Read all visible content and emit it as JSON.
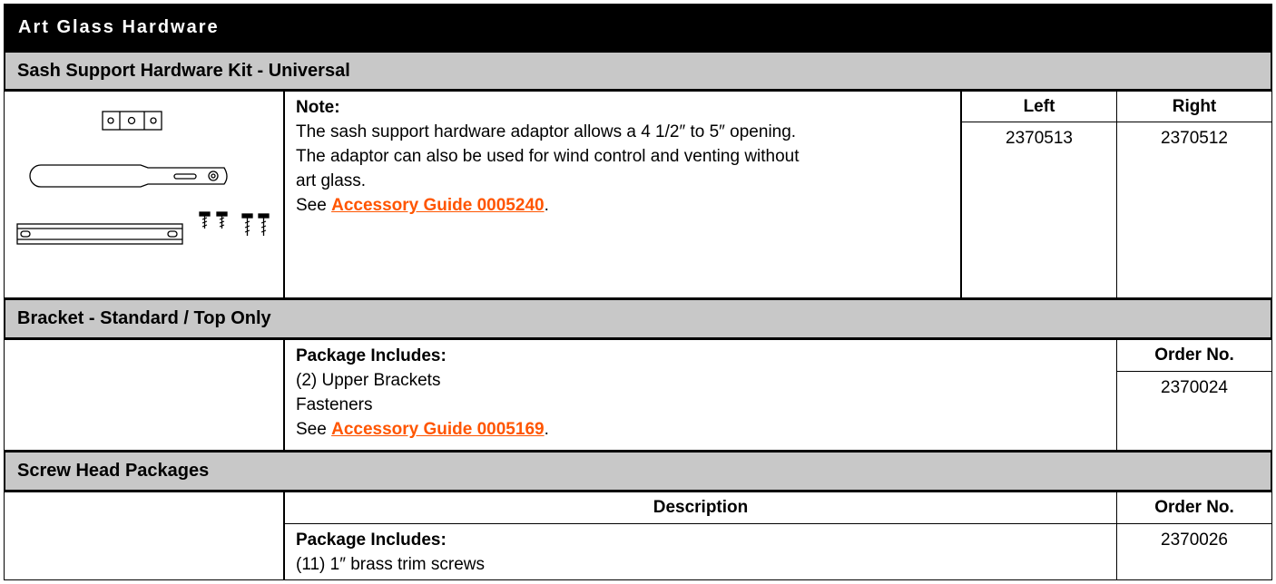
{
  "title": "Art Glass Hardware",
  "sash": {
    "heading": "Sash Support Hardware Kit - Universal",
    "note_label": "Note:",
    "note_line1": "The sash support hardware adaptor allows a 4 1/2″ to 5″ opening.",
    "note_line2": "The adaptor can also be used for wind control and venting without",
    "note_line3": "art glass.",
    "see_prefix": "See ",
    "guide_link": "Accessory Guide 0005240",
    "see_suffix": ".",
    "col_left": "Left",
    "col_right": "Right",
    "left_value": "2370513",
    "right_value": "2370512"
  },
  "bracket": {
    "heading": "Bracket - Standard / Top Only",
    "includes_label": "Package Includes:",
    "item1": "(2) Upper Brackets",
    "item2": "Fasteners",
    "see_prefix": "See ",
    "guide_link": "Accessory Guide 0005169",
    "see_suffix": ".",
    "order_header": "Order No.",
    "order_value": "2370024"
  },
  "screw": {
    "heading": "Screw Head Packages",
    "desc_header": "Description",
    "order_header": "Order No.",
    "includes_label": "Package Includes:",
    "item1": "(11) 1″ brass trim screws",
    "order_value": "2370026"
  }
}
